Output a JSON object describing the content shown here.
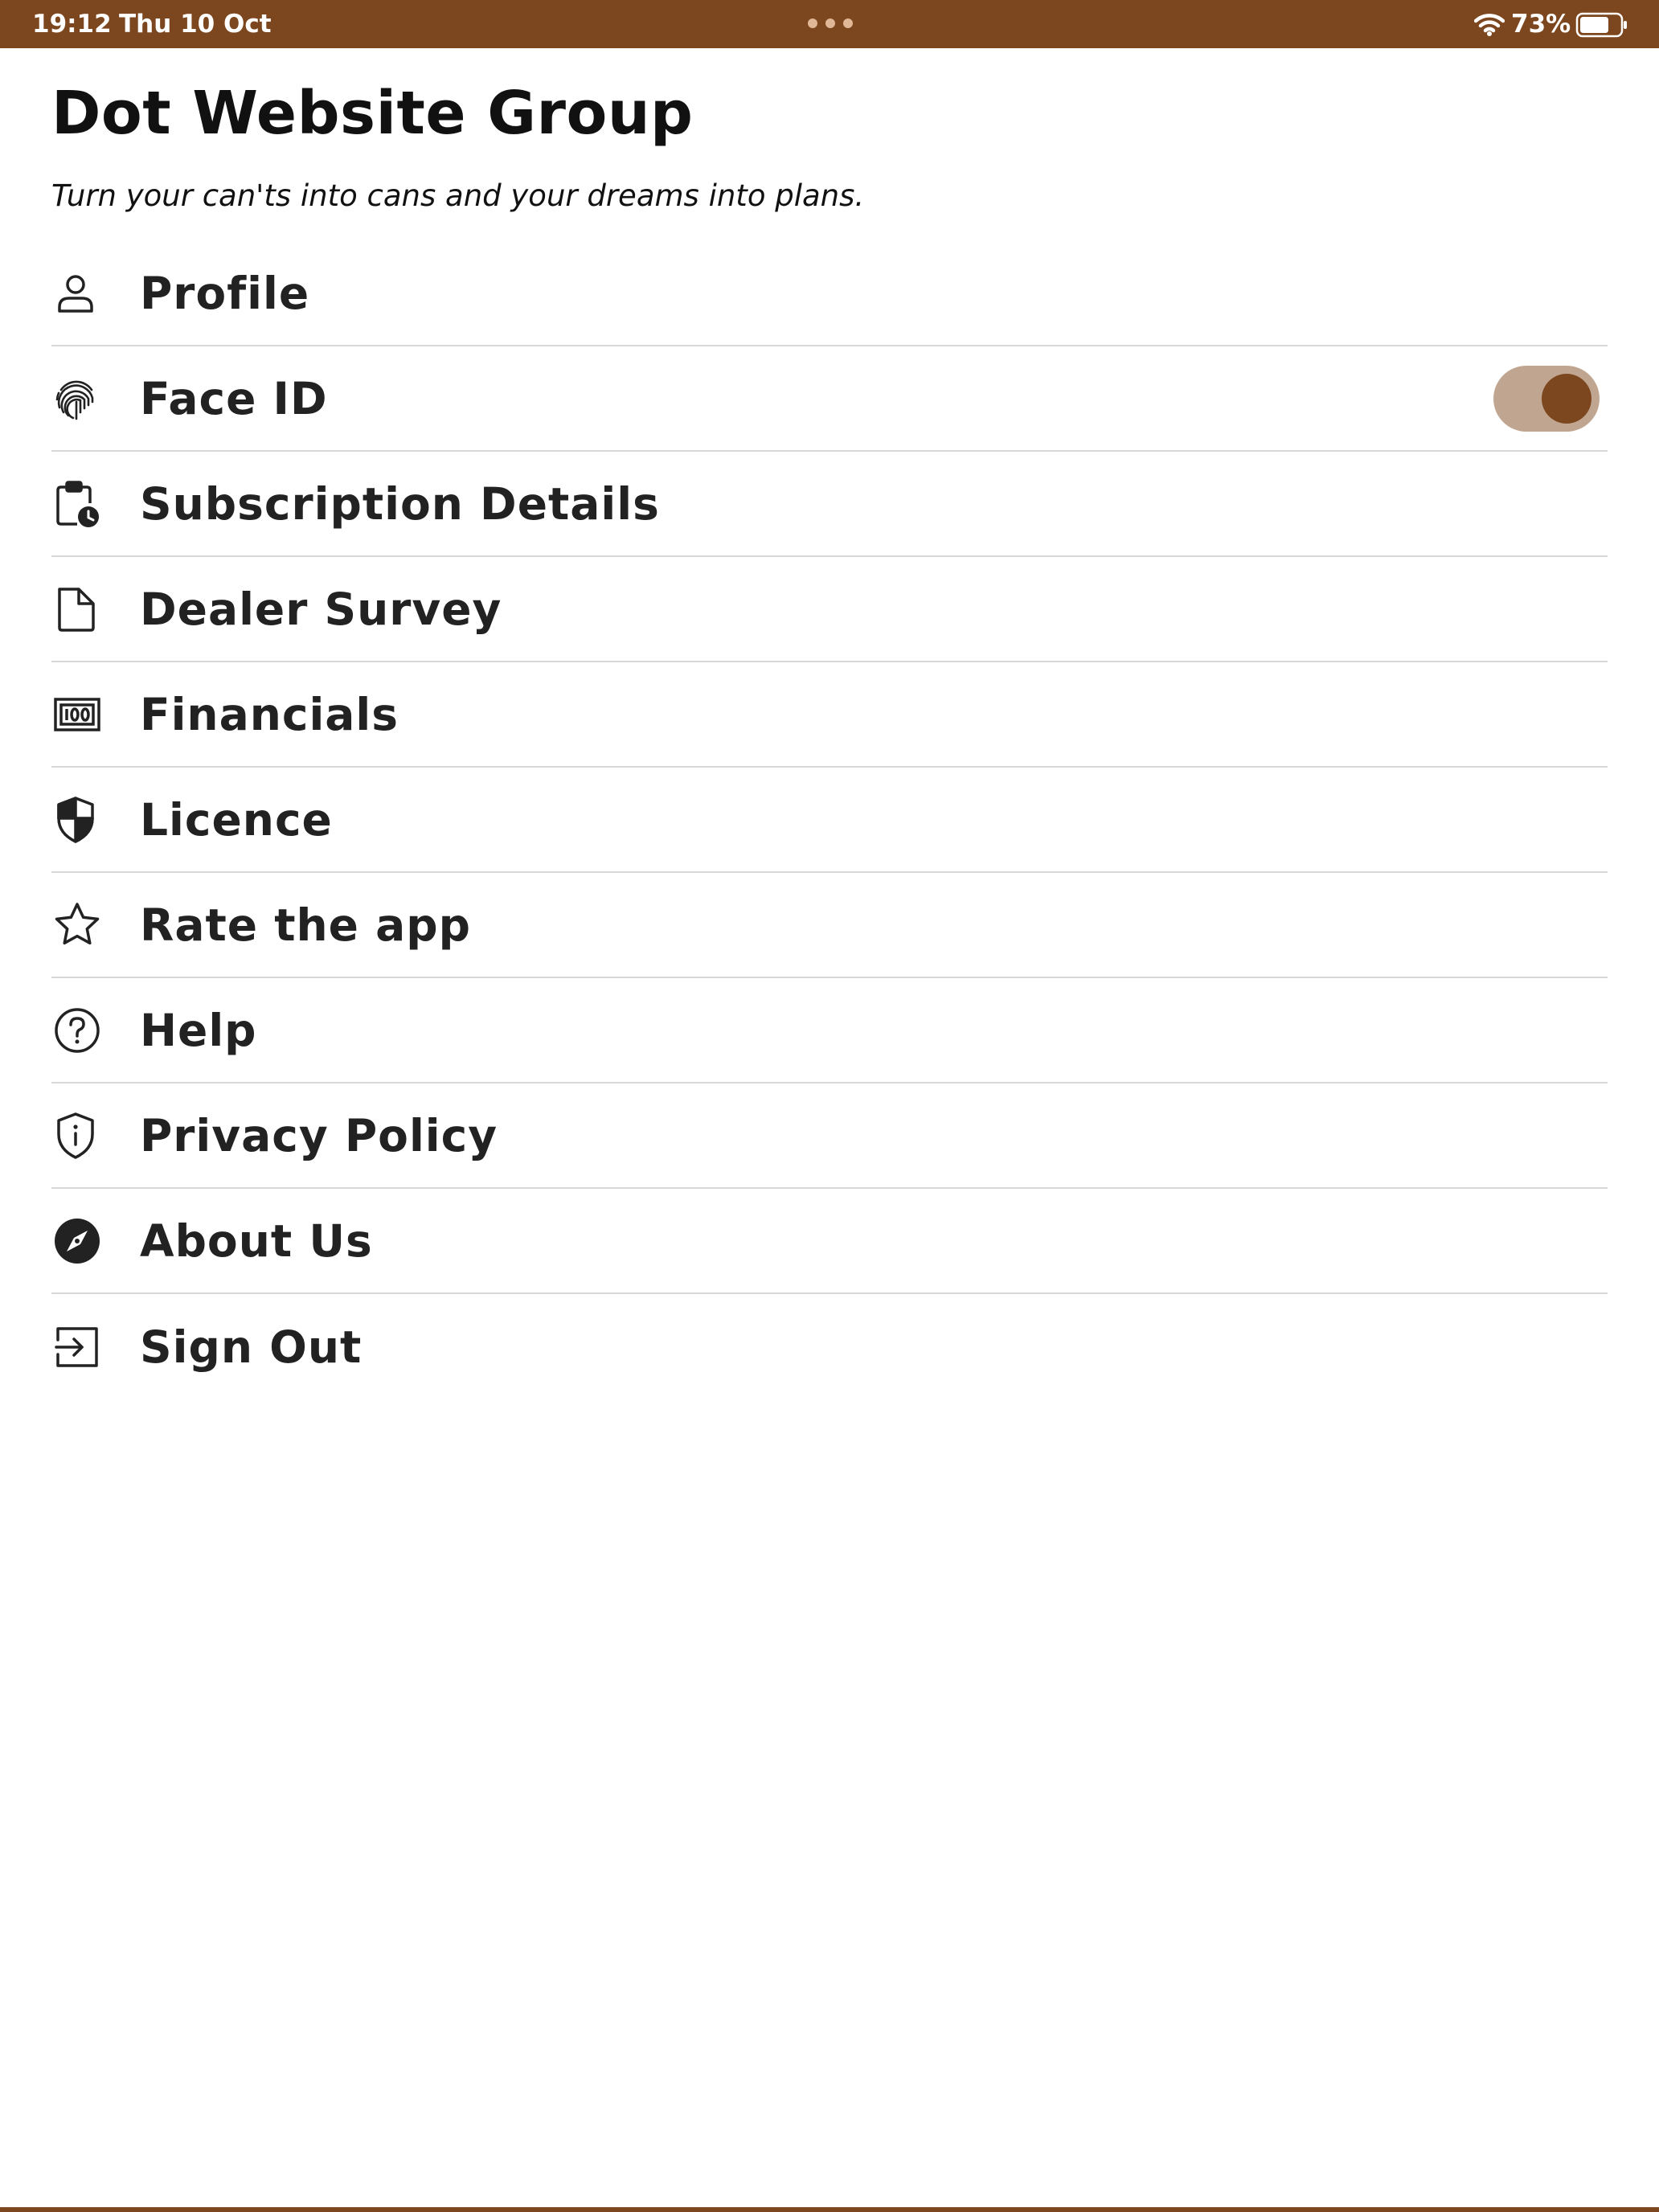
{
  "status_bar": {
    "time": "19:12",
    "date": "Thu 10 Oct",
    "battery_percent": "73%",
    "battery_level": 0.73,
    "background_color": "#7c461e"
  },
  "header": {
    "title": "Dot Website Group",
    "tagline": "Turn your can'ts into cans and your dreams into plans."
  },
  "menu": {
    "items": [
      {
        "label": "Profile",
        "icon": "person-icon"
      },
      {
        "label": "Face ID",
        "icon": "fingerprint-icon",
        "toggle": true
      },
      {
        "label": "Subscription Details",
        "icon": "clipboard-clock-icon"
      },
      {
        "label": "Dealer Survey",
        "icon": "document-icon"
      },
      {
        "label": "Financials",
        "icon": "banknote-icon"
      },
      {
        "label": "Licence",
        "icon": "shield-half-icon"
      },
      {
        "label": "Rate the app",
        "icon": "star-icon"
      },
      {
        "label": "Help",
        "icon": "question-circle-icon"
      },
      {
        "label": "Privacy Policy",
        "icon": "shield-info-icon"
      },
      {
        "label": "About Us",
        "icon": "compass-icon"
      },
      {
        "label": "Sign Out",
        "icon": "sign-out-icon"
      }
    ]
  },
  "face_id_toggle": {
    "on": true,
    "track_color": "#c0a590",
    "knob_color": "#7c461e"
  }
}
